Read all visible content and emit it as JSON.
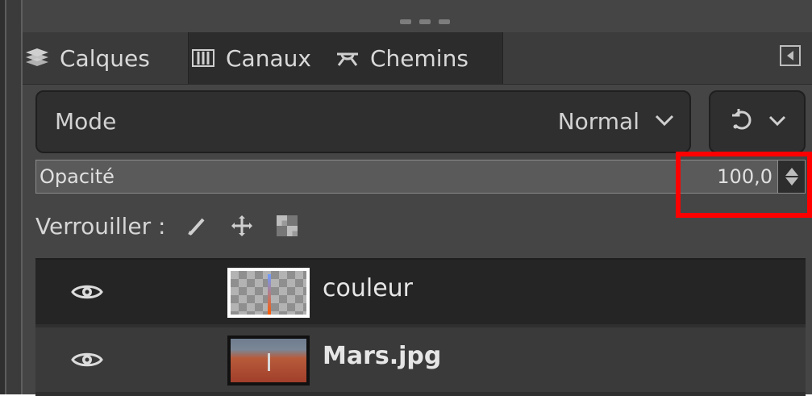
{
  "tabs": [
    {
      "label": "Calques",
      "icon": "layers-icon"
    },
    {
      "label": "Canaux",
      "icon": "channels-icon"
    },
    {
      "label": "Chemins",
      "icon": "paths-icon"
    }
  ],
  "mode": {
    "label": "Mode",
    "value": "Normal"
  },
  "opacity": {
    "label": "Opacité",
    "value": "100,0"
  },
  "lock": {
    "label": "Verrouiller :"
  },
  "layers": [
    {
      "name": "couleur",
      "visible": true
    },
    {
      "name": "Mars.jpg",
      "visible": true
    }
  ],
  "colors": {
    "highlight": "#ff0000",
    "panel_bg": "#454545"
  }
}
